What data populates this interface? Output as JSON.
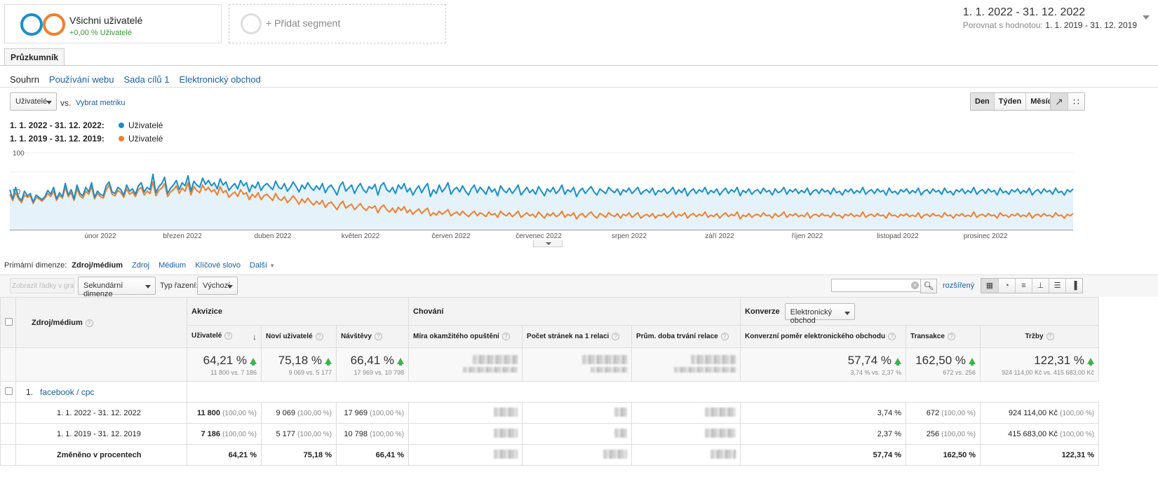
{
  "segments": {
    "active": {
      "title": "Všichni uživatelé",
      "sub": "+0,00 % Uživatelé"
    },
    "add_label": "+ Přidat segment"
  },
  "date_range": {
    "main": "1. 1. 2022 - 31. 12. 2022",
    "compare_label": "Porovnat s hodnotou:",
    "compare_value": "1. 1. 2019 - 31. 12. 2019"
  },
  "tabs": {
    "explorer": "Průzkumník",
    "subtabs": [
      "Souhrn",
      "Používání webu",
      "Sada cílů 1",
      "Elektronický obchod"
    ]
  },
  "metric": {
    "selected": "Uživatelé",
    "vs": "vs.",
    "pick": "Vybrat metriku"
  },
  "granularity": [
    "Den",
    "Týden",
    "Měsíc"
  ],
  "chart_type_icons": [
    "line-chart-icon",
    "motion-chart-icon"
  ],
  "legend": [
    {
      "range": "1. 1. 2022 - 31. 12. 2022:",
      "name": "Uživatelé",
      "color": "#1a8fc9"
    },
    {
      "range": "1. 1. 2019 - 31. 12. 2019:",
      "name": "Uživatelé",
      "color": "#f07f2e"
    }
  ],
  "chart_data": {
    "type": "line",
    "y_ticks": [
      "100",
      "50"
    ],
    "ylim": [
      0,
      100
    ],
    "x_labels": [
      "únor 2022",
      "březen 2022",
      "duben 2022",
      "květen 2022",
      "červen 2022",
      "červenec 2022",
      "srpen 2022",
      "září 2022",
      "říjen 2022",
      "listopad 2022",
      "prosinec 2022"
    ],
    "series": [
      {
        "name": "Uživatelé",
        "color": "#1a8fc9",
        "values": [
          52,
          40,
          55,
          42,
          38,
          50,
          44,
          47,
          36,
          45,
          42,
          39,
          43,
          51,
          46,
          55,
          40,
          48,
          43,
          60,
          45,
          52,
          40,
          58,
          47,
          44,
          55,
          49,
          61,
          42,
          50,
          46,
          44,
          57,
          62,
          49,
          47,
          55,
          52,
          45,
          58,
          50,
          53,
          46,
          57,
          61,
          49,
          55,
          52,
          72,
          48,
          56,
          60,
          68,
          47,
          54,
          58,
          64,
          52,
          61,
          57,
          70,
          50,
          63,
          58,
          55,
          67,
          59,
          64,
          57,
          61,
          53,
          66,
          58,
          62,
          51,
          56,
          60,
          53,
          64,
          57,
          61,
          49,
          58,
          54,
          62,
          51,
          57,
          60,
          56,
          52,
          63,
          55,
          53,
          60,
          50,
          55,
          62,
          56,
          49,
          58,
          53,
          61,
          55,
          51,
          57,
          52,
          60,
          48,
          55,
          58,
          52,
          45,
          57,
          62,
          50,
          54,
          58,
          47,
          55,
          60,
          52,
          48,
          56,
          53,
          59,
          45,
          57,
          61,
          52,
          49,
          55,
          47,
          58,
          53,
          60,
          49,
          54,
          45,
          52,
          57,
          48,
          55,
          60,
          43,
          52,
          47,
          58,
          49,
          54,
          61,
          46,
          52,
          55,
          49,
          57,
          50,
          45,
          53,
          58,
          48,
          55,
          51,
          46,
          56,
          49,
          53,
          44,
          57,
          51,
          48,
          54,
          47,
          52,
          58,
          45,
          50,
          55,
          48,
          52,
          46,
          56,
          50,
          44,
          53,
          49,
          55,
          47,
          51,
          58,
          46,
          52,
          49,
          55,
          43,
          50,
          54,
          47,
          52,
          56,
          49,
          45,
          53,
          50,
          47,
          55,
          51,
          48,
          53,
          45,
          52,
          49,
          54,
          47,
          51,
          55,
          46,
          50,
          52,
          48,
          54,
          45,
          51,
          49,
          53,
          47,
          50,
          55,
          46,
          52,
          48,
          54,
          44,
          50,
          53,
          47,
          52,
          49,
          55,
          46,
          51,
          48,
          53,
          45,
          50,
          54,
          47,
          52,
          49,
          55,
          44,
          51,
          48,
          53,
          46,
          50,
          52,
          47,
          54,
          49,
          51,
          45,
          53,
          48,
          50,
          55,
          46,
          52,
          49,
          53,
          47,
          51,
          48,
          54,
          45,
          50,
          52,
          47,
          53,
          49,
          51,
          46,
          54,
          48,
          50,
          45,
          52,
          49,
          53,
          47,
          51,
          48,
          55,
          46,
          50,
          52,
          47,
          53,
          49,
          51,
          45,
          54,
          48,
          50,
          46,
          52,
          49,
          53,
          47,
          51,
          48,
          54,
          45,
          50,
          52,
          47,
          53,
          49,
          51,
          46,
          54,
          48,
          50,
          45,
          52,
          49,
          53,
          47,
          51,
          48,
          55,
          46,
          50,
          52,
          47,
          53,
          49,
          51,
          45,
          54,
          48,
          50,
          46,
          52,
          49,
          53,
          47,
          51,
          48,
          54,
          45,
          50,
          52,
          47,
          53,
          49,
          51,
          46,
          54,
          48,
          50,
          45,
          52,
          49,
          53
        ]
      },
      {
        "name": "Uživatelé",
        "color": "#f07f2e",
        "values": [
          46,
          38,
          48,
          40,
          35,
          45,
          42,
          44,
          34,
          42,
          40,
          37,
          41,
          47,
          43,
          50,
          38,
          45,
          41,
          55,
          43,
          48,
          38,
          53,
          44,
          41,
          50,
          46,
          56,
          40,
          47,
          43,
          41,
          52,
          58,
          46,
          44,
          51,
          48,
          42,
          53,
          46,
          49,
          43,
          52,
          55,
          45,
          50,
          47,
          62,
          44,
          51,
          54,
          60,
          43,
          49,
          52,
          57,
          47,
          54,
          50,
          61,
          45,
          56,
          51,
          48,
          58,
          51,
          55,
          49,
          52,
          45,
          56,
          48,
          51,
          42,
          46,
          49,
          43,
          52,
          46,
          48,
          39,
          46,
          42,
          48,
          39,
          44,
          46,
          42,
          38,
          47,
          40,
          38,
          43,
          35,
          39,
          44,
          39,
          33,
          40,
          35,
          41,
          36,
          32,
          37,
          33,
          38,
          29,
          34,
          36,
          31,
          26,
          33,
          37,
          28,
          31,
          33,
          26,
          30,
          34,
          28,
          25,
          30,
          28,
          31,
          22,
          29,
          32,
          26,
          23,
          28,
          22,
          29,
          25,
          30,
          22,
          26,
          20,
          24,
          27,
          21,
          25,
          28,
          18,
          22,
          19,
          24,
          20,
          23,
          26,
          18,
          21,
          23,
          19,
          24,
          20,
          17,
          21,
          24,
          18,
          22,
          20,
          17,
          23,
          19,
          21,
          16,
          24,
          20,
          18,
          22,
          17,
          20,
          24,
          16,
          19,
          22,
          18,
          20,
          16,
          23,
          19,
          15,
          21,
          18,
          22,
          17,
          19,
          24,
          16,
          20,
          18,
          22,
          14,
          19,
          21,
          16,
          20,
          23,
          18,
          15,
          21,
          19,
          16,
          22,
          19,
          17,
          21,
          15,
          20,
          18,
          22,
          16,
          19,
          22,
          15,
          18,
          20,
          17,
          21,
          15,
          19,
          18,
          21,
          16,
          19,
          23,
          16,
          20,
          18,
          22,
          15,
          19,
          21,
          17,
          20,
          18,
          23,
          16,
          19,
          17,
          21,
          15,
          19,
          22,
          17,
          20,
          18,
          23,
          14,
          19,
          17,
          21,
          16,
          19,
          20,
          17,
          22,
          18,
          19,
          15,
          21,
          17,
          19,
          23,
          16,
          20,
          18,
          21,
          17,
          19,
          17,
          22,
          15,
          19,
          20,
          17,
          21,
          18,
          19,
          16,
          22,
          18,
          19,
          15,
          20,
          18,
          21,
          17,
          19,
          17,
          23,
          16,
          19,
          20,
          17,
          21,
          18,
          19,
          15,
          22,
          18,
          19,
          16,
          20,
          18,
          21,
          17,
          19,
          17,
          22,
          15,
          19,
          20,
          17,
          21,
          18,
          19,
          16,
          22,
          18,
          19,
          15,
          20,
          18,
          21,
          17,
          19,
          17,
          23,
          16,
          19,
          20,
          17,
          21,
          18,
          19,
          15,
          22,
          18,
          19,
          16,
          20,
          18,
          21,
          17,
          19,
          17,
          22,
          15,
          19,
          20,
          17,
          21,
          18,
          19,
          16,
          22,
          18,
          19,
          15,
          20,
          18,
          21
        ]
      }
    ]
  },
  "dimensions": {
    "label": "Primární dimenze:",
    "current": "Zdroj/médium",
    "links": [
      "Zdroj",
      "Médium",
      "Klíčové slovo",
      "Další"
    ]
  },
  "toolbar": {
    "plot_rows": "Zobrazit řádky v grafu",
    "secondary": "Sekundární dimenze",
    "sort_label": "Typ řazení:",
    "sort_value": "Výchozí",
    "advanced": "rozšířený",
    "search_placeholder": ""
  },
  "table": {
    "dim_header": "Zdroj/médium",
    "groups": {
      "acq": "Akvizice",
      "beh": "Chování",
      "conv": "Konverze",
      "conv_select": "Elektronický obchod"
    },
    "cols": [
      "Uživatelé",
      "Noví uživatelé",
      "Návštěvy",
      "Míra okamžitého opuštění",
      "Počet stránek na 1 relaci",
      "Prům. doba trvání relace",
      "Konverzní poměr elektronického obchodu",
      "Transakce",
      "Tržby"
    ],
    "totals": {
      "users": {
        "pct": "64,21 %",
        "cmp": "11 800 vs. 7 186"
      },
      "new_users": {
        "pct": "75,18 %",
        "cmp": "9 069 vs. 5 177"
      },
      "sessions": {
        "pct": "66,41 %",
        "cmp": "17 969 vs. 10 798"
      },
      "conv_rate": {
        "pct": "57,74 %",
        "cmp": "3,74 % vs. 2,37 %"
      },
      "transactions": {
        "pct": "162,50 %",
        "cmp": "672 vs. 256"
      },
      "revenue": {
        "pct": "122,31 %",
        "cmp": "924 114,00 Kč vs. 415 683,00 Kč"
      }
    },
    "row": {
      "index": "1.",
      "name": "facebook / cpc"
    },
    "r2022": {
      "label": "1. 1. 2022 - 31. 12. 2022",
      "users": "11 800",
      "users_p": "(100,00 %)",
      "new": "9 069",
      "new_p": "(100,00 %)",
      "sess": "17 969",
      "sess_p": "(100,00 %)",
      "conv": "3,74 %",
      "trans": "672",
      "trans_p": "(100,00 %)",
      "rev": "924 114,00 Kč",
      "rev_p": "(100,00 %)"
    },
    "r2019": {
      "label": "1. 1. 2019 - 31. 12. 2019",
      "users": "7 186",
      "users_p": "(100,00 %)",
      "new": "5 177",
      "new_p": "(100,00 %)",
      "sess": "10 798",
      "sess_p": "(100,00 %)",
      "conv": "2,37 %",
      "trans": "256",
      "trans_p": "(100,00 %)",
      "rev": "415 683,00 Kč",
      "rev_p": "(100,00 %)"
    },
    "change": {
      "label": "Změněno v procentech",
      "users": "64,21 %",
      "new": "75,18 %",
      "sess": "66,41 %",
      "conv": "57,74 %",
      "trans": "162,50 %",
      "rev": "122,31 %"
    }
  }
}
